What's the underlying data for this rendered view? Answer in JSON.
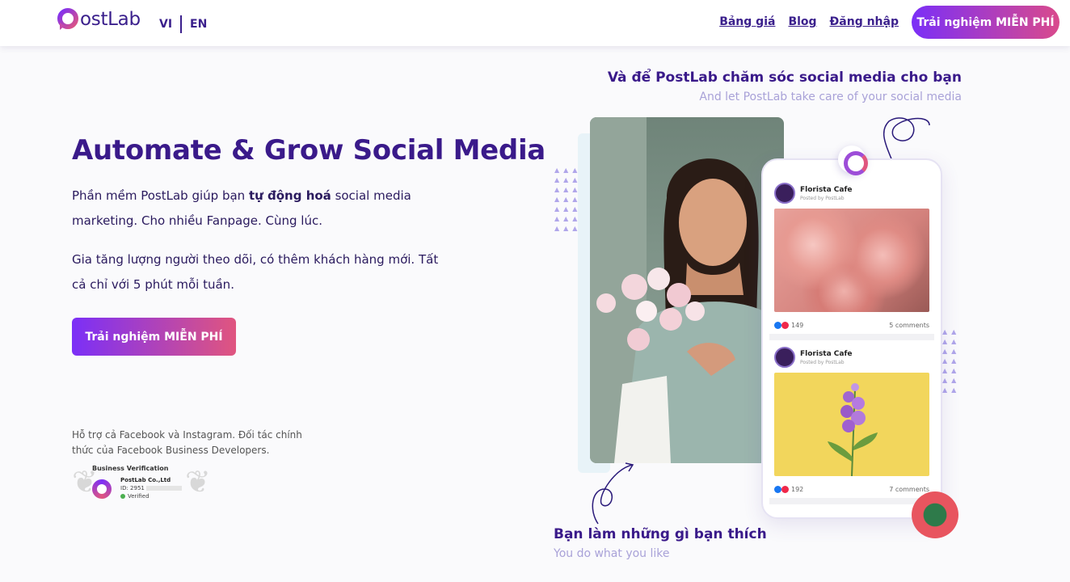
{
  "header": {
    "logo_text": "ostLab",
    "lang_vi": "VI",
    "lang_en": "EN",
    "nav": [
      "Bảng giá",
      "Blog",
      "Đăng nhập"
    ],
    "cta": "Trải nghiệm MIỄN PHÍ"
  },
  "hero": {
    "title": "Automate & Grow Social Media",
    "p1_before": "Phần mềm PostLab giúp bạn ",
    "p1_bold": "tự động hoá",
    "p1_after": " social media marketing. Cho nhiều Fanpage. Cùng lúc.",
    "p2": "Gia tăng lượng người theo dõi, có thêm khách hàng mới. Tất cả chỉ với 5 phút mỗi tuần.",
    "cta": "Trải nghiệm MIỄN PHÍ",
    "support": "Hỗ trợ cả Facebook và Instagram. Đối tác chính thức của Facebook Business Developers."
  },
  "verification": {
    "title": "Business Verification",
    "company": "PostLab Co.,Ltd",
    "id_label": "ID: 2951",
    "status": "Verified"
  },
  "captions": {
    "top_vi": "Và để PostLab chăm sóc social media cho bạn",
    "top_en": "And let PostLab take care of your social media",
    "bottom_vi": "Bạn làm những gì bạn thích",
    "bottom_en": "You do what you like"
  },
  "posts": [
    {
      "name": "Florista Cafe",
      "by": "Posted by PostLab",
      "likes": "149",
      "comments": "5 comments"
    },
    {
      "name": "Florista Cafe",
      "by": "Posted by PostLab",
      "likes": "192",
      "comments": "7 comments"
    }
  ],
  "colors": {
    "brand": "#3a1f8c",
    "gradient_start": "#7b2ff7",
    "gradient_end": "#e0557f"
  }
}
